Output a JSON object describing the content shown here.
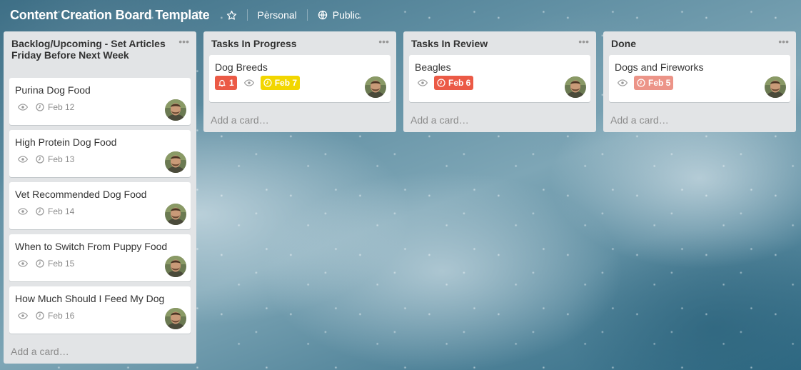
{
  "header": {
    "title": "Content Creation Board Template",
    "personal_label": "Personal",
    "public_label": "Public"
  },
  "colors": {
    "list_bg": "#e2e4e6",
    "red": "#eb5a46",
    "yellow": "#f2d600",
    "faded_red": "#ec9488",
    "text_muted": "#8c8c8c"
  },
  "lists": [
    {
      "title": "Backlog/Upcoming - Set Articles Friday Before Next Week",
      "cards": [
        {
          "title": "Purina Dog Food",
          "date": "Feb 12"
        },
        {
          "title": "High Protein Dog Food",
          "date": "Feb 13"
        },
        {
          "title": "Vet Recommended Dog Food",
          "date": "Feb 14"
        },
        {
          "title": "When to Switch From Puppy Food",
          "date": "Feb 15"
        },
        {
          "title": "How Much Should I Feed My Dog",
          "date": "Feb 16"
        }
      ],
      "add_label": "Add a card…"
    },
    {
      "title": "Tasks In Progress",
      "cards": [
        {
          "title": "Dog Breeds",
          "notification_count": "1",
          "date": "Feb 7",
          "date_status": "due-soon"
        }
      ],
      "add_label": "Add a card…"
    },
    {
      "title": "Tasks In Review",
      "cards": [
        {
          "title": "Beagles",
          "date": "Feb 6",
          "date_status": "overdue"
        }
      ],
      "add_label": "Add a card…"
    },
    {
      "title": "Done",
      "cards": [
        {
          "title": "Dogs and Fireworks",
          "date": "Feb 5",
          "date_status": "past"
        }
      ],
      "add_label": "Add a card…"
    }
  ]
}
